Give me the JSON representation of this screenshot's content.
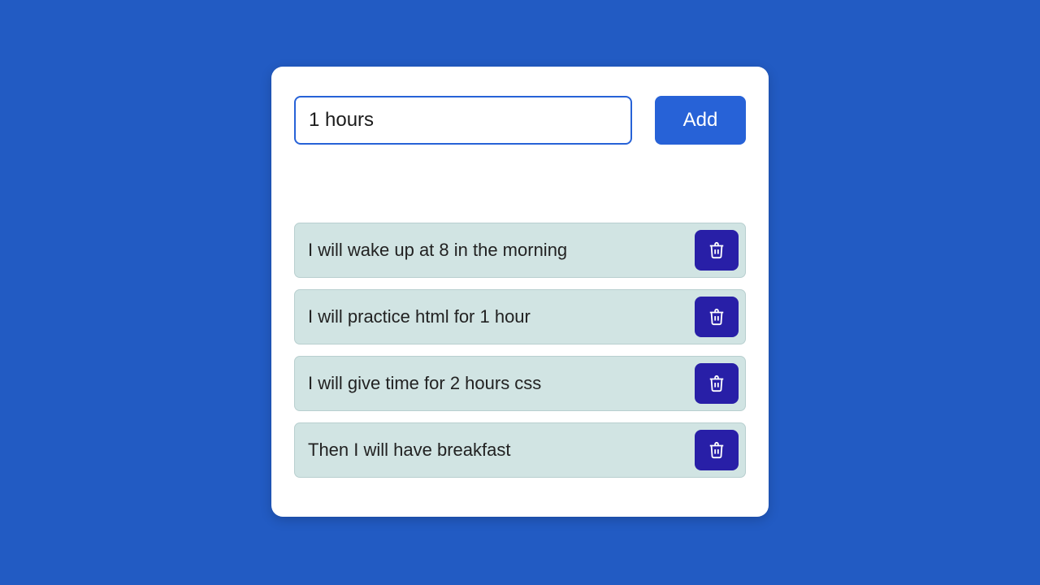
{
  "input": {
    "value": "1 hours ",
    "placeholder": ""
  },
  "buttons": {
    "add_label": "Add"
  },
  "todos": [
    {
      "text": "I will wake up at 8 in the morning"
    },
    {
      "text": "I will practice html for 1 hour"
    },
    {
      "text": "I will give time for 2 hours css"
    },
    {
      "text": "Then I will have breakfast"
    }
  ],
  "colors": {
    "page_bg": "#225bc3",
    "card_bg": "#ffffff",
    "accent": "#2762d7",
    "delete_bg": "#281fa7",
    "item_bg": "#d1e4e3"
  }
}
